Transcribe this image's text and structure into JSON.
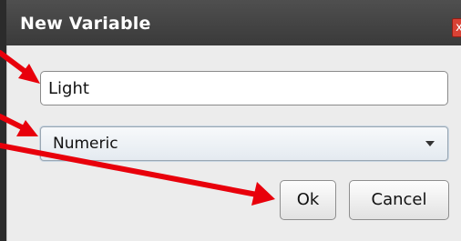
{
  "dialog": {
    "title": "New Variable",
    "close_glyph": "x"
  },
  "form": {
    "name_value": "Light",
    "type_selected": "Numeric"
  },
  "buttons": {
    "ok_label": "Ok",
    "cancel_label": "Cancel"
  },
  "annotation": {
    "arrow_color": "#e8000b"
  }
}
